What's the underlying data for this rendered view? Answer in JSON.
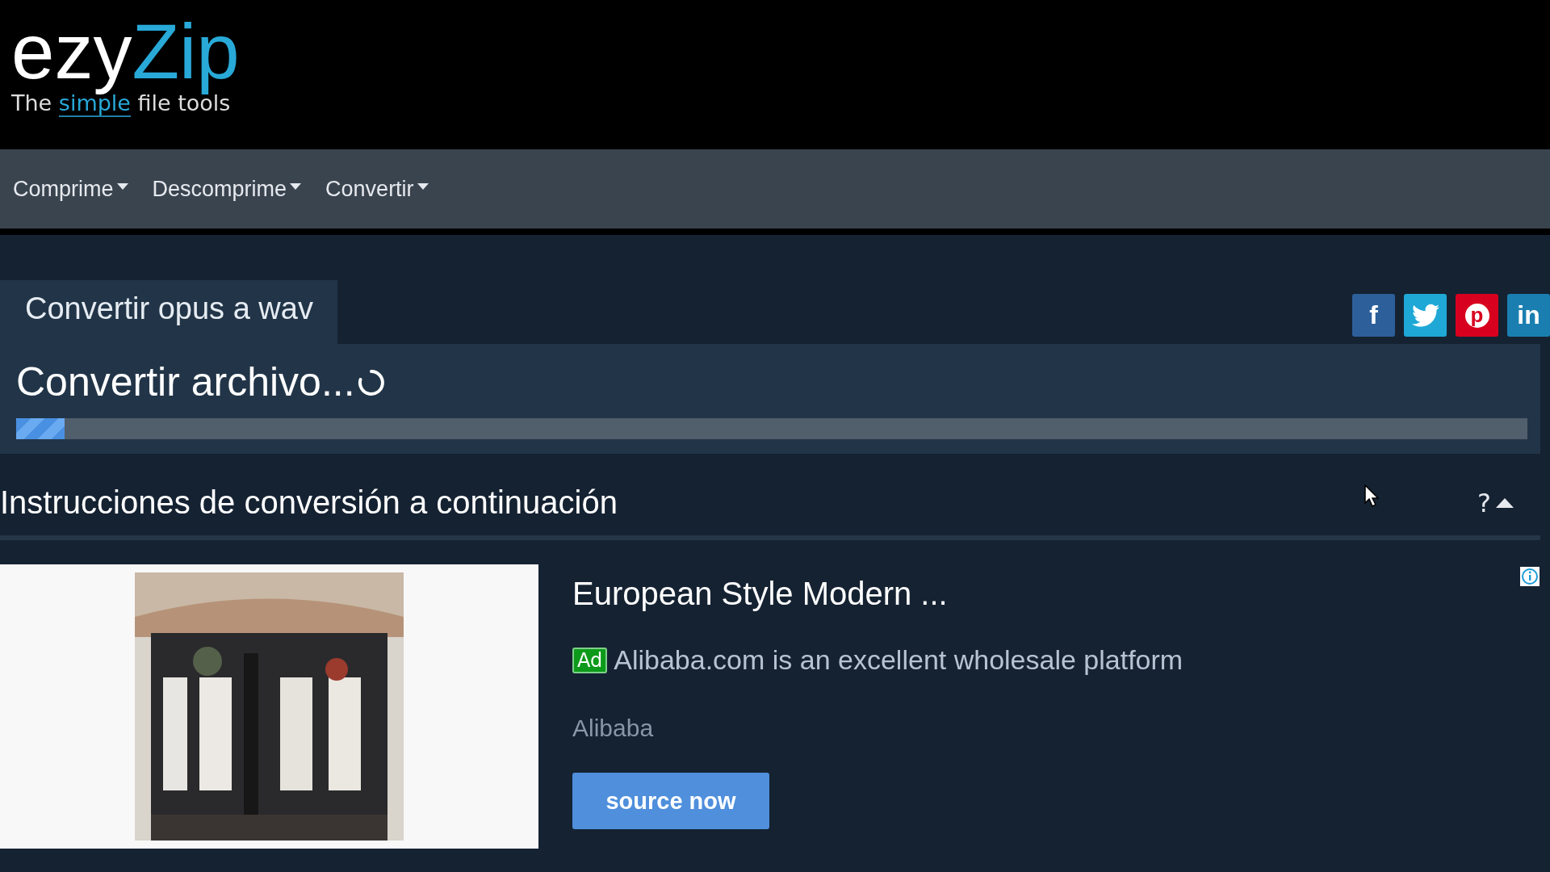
{
  "logo": {
    "first": "ezy",
    "second": "Zip"
  },
  "tagline": {
    "before": "The",
    "highlight": "simple",
    "after": "file tools"
  },
  "nav": [
    {
      "label": "Comprime"
    },
    {
      "label": "Descomprime"
    },
    {
      "label": "Convertir"
    }
  ],
  "tab": {
    "label": "Convertir opus a wav"
  },
  "social": [
    {
      "kind": "facebook",
      "label": "f"
    },
    {
      "kind": "twitter"
    },
    {
      "kind": "pinterest",
      "label": "p"
    },
    {
      "kind": "linkedin",
      "label": "in"
    }
  ],
  "progress": {
    "title": "Convertir archivo...",
    "level": 0.032
  },
  "instructions": {
    "title": "Instrucciones de conversión a continuación",
    "help": "?",
    "expanded": true
  },
  "ad": {
    "title": "European Style Modern ...",
    "badge": "Ad",
    "text": "Alibaba.com is an excellent wholesale platform",
    "advertiser": "Alibaba",
    "button": "source now"
  }
}
